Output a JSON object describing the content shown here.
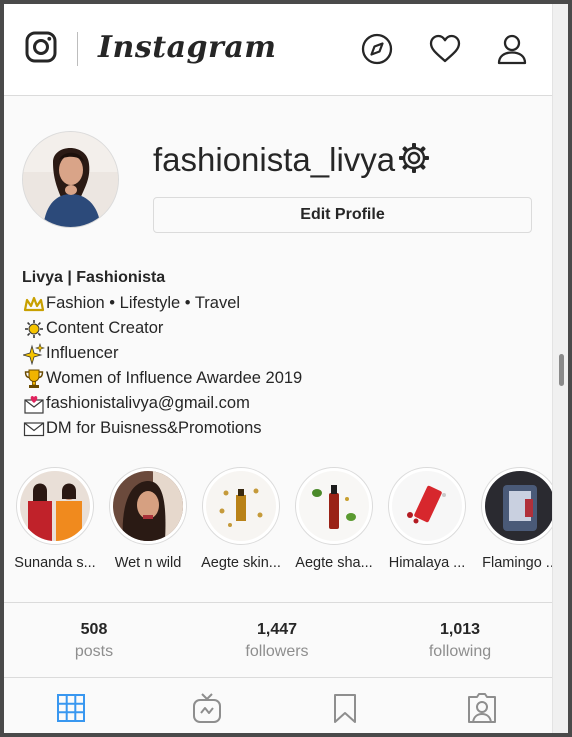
{
  "header": {
    "wordmark": "Instagram",
    "icons": [
      "instagram-camera-icon",
      "compass-icon",
      "heart-icon",
      "user-icon"
    ]
  },
  "profile": {
    "username": "fashionista_livya",
    "edit_label": "Edit Profile",
    "bio_name": "Livya | Fashionista",
    "bio_lines": [
      {
        "icon": "crown-emoji-icon",
        "text": "Fashion • Lifestyle • Travel"
      },
      {
        "icon": "sun-emoji-icon",
        "text": "Content Creator"
      },
      {
        "icon": "sparkles-emoji-icon",
        "text": "Influencer"
      },
      {
        "icon": "trophy-emoji-icon",
        "text": "Women of Influence Awardee 2019"
      },
      {
        "icon": "envelope-heart-emoji-icon",
        "text": "fashionistalivya@gmail.com"
      },
      {
        "icon": "envelope-emoji-icon",
        "text": "DM for Buisness&Promotions"
      }
    ]
  },
  "highlights": [
    {
      "label": "Sunanda s..."
    },
    {
      "label": "Wet n wild"
    },
    {
      "label": "Aegte skin..."
    },
    {
      "label": "Aegte sha..."
    },
    {
      "label": "Himalaya ..."
    },
    {
      "label": "Flamingo ..."
    }
  ],
  "stats": {
    "posts": {
      "value": "508",
      "label": "posts"
    },
    "followers": {
      "value": "1,447",
      "label": "followers"
    },
    "following": {
      "value": "1,013",
      "label": "following"
    }
  },
  "tabs": [
    "grid-icon",
    "igtv-icon",
    "saved-icon",
    "tagged-icon"
  ],
  "colors": {
    "active_tab": "#3897f0",
    "inactive": "#8e8e8e",
    "text": "#262626",
    "border": "#dbdbdb"
  }
}
